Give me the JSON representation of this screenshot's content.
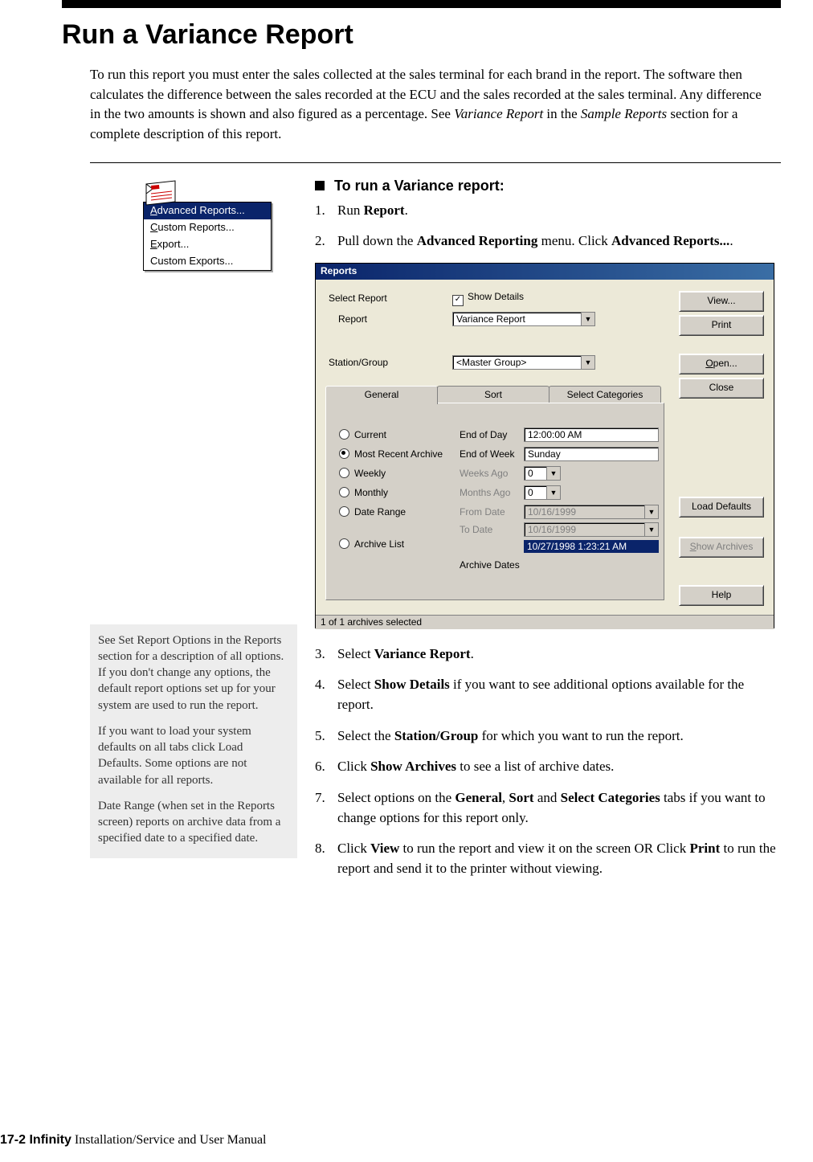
{
  "heading": "Run a Variance Report",
  "intro_a": "To run this report you must enter the sales collected at the sales terminal for each brand in the report. The software then calculates the difference between the sales recorded at the ECU and the sales recorded at the sales terminal. Any difference in the two amounts is shown and also figured as a percentage. See ",
  "intro_b": "Variance Report",
  "intro_c": " in the ",
  "intro_d": "Sample Reports",
  "intro_e": " section for a complete description of this report.",
  "task_title": "To run a Variance report:",
  "steps": {
    "s1_a": "Run ",
    "s1_b": "Report",
    "s1_c": ".",
    "s2_a": "Pull down the ",
    "s2_b": "Advanced Reporting",
    "s2_c": " menu. Click ",
    "s2_d": "Advanced Reports...",
    "s2_e": ".",
    "s3_a": "Select ",
    "s3_b": "Variance Report",
    "s3_c": ".",
    "s4_a": "Select ",
    "s4_b": "Show Details",
    "s4_c": " if you want to see additional options available for the report.",
    "s5_a": "Select the ",
    "s5_b": "Station/Group",
    "s5_c": " for which you want to run the report.",
    "s6_a": "Click ",
    "s6_b": "Show Archives",
    "s6_c": " to see a list of archive dates.",
    "s7_a": "Select options on the ",
    "s7_b": "General",
    "s7_c": ", ",
    "s7_d": "Sort",
    "s7_e": " and ",
    "s7_f": "Select Categories",
    "s7_g": " tabs if you want to change options for this report only.",
    "s8_a": "Click ",
    "s8_b": "View",
    "s8_c": " to run the report and view it on the screen OR Click ",
    "s8_d": "Print",
    "s8_e": " to run the report and send it to the printer without viewing."
  },
  "nums": {
    "n1": "1.",
    "n2": "2.",
    "n3": "3.",
    "n4": "4.",
    "n5": "5.",
    "n6": "6.",
    "n7": "7.",
    "n8": "8."
  },
  "dropdown": {
    "i0_u": "A",
    "i0_r": "dvanced Reports...",
    "i1_u": "C",
    "i1_r": "ustom Reports...",
    "i2_u": "E",
    "i2_r": "xport...",
    "i3": "Custom Exports..."
  },
  "notes": {
    "p1": "See Set Report Options in the Reports section for a description of all options. If you don't change any options, the default report options set up for your system are used to run the report.",
    "p2": "If you want to load your system defaults on all tabs click Load Defaults. Some options are not available for all reports.",
    "p3": "Date Range (when set in the Reports screen) reports on archive data from a specified date to a specified date."
  },
  "dlg": {
    "title": "Reports",
    "select_report": "Select Report",
    "show_details": "Show Details",
    "report": "Report",
    "report_value": "Variance Report",
    "station_group": "Station/Group",
    "station_value": "<Master Group>",
    "tabs": {
      "general": "General",
      "sort": "Sort",
      "select_categories": "Select Categories"
    },
    "radios": {
      "current": "Current",
      "most_recent": "Most Recent Archive",
      "weekly": "Weekly",
      "monthly": "Monthly",
      "date_range": "Date Range",
      "archive_list": "Archive List"
    },
    "labels": {
      "end_of_day": "End of Day",
      "end_of_week": "End of Week",
      "weeks_ago": "Weeks Ago",
      "months_ago": "Months Ago",
      "from_date": "From Date",
      "to_date": "To Date",
      "archive_dates": "Archive Dates"
    },
    "values": {
      "end_of_day": "12:00:00 AM",
      "end_of_week": "Sunday",
      "weeks_ago": "0",
      "months_ago": "0",
      "from_date": "10/16/1999",
      "to_date": "10/16/1999",
      "archive_selected": "10/27/1998 1:23:21 AM"
    },
    "buttons": {
      "view": "View...",
      "print": "Print",
      "open_u": "O",
      "open_r": "pen...",
      "close": "Close",
      "load_defaults": "Load Defaults",
      "show_archives_u": "S",
      "show_archives_r": "how Archives",
      "help": "Help"
    },
    "status": "1 of 1 archives selected"
  },
  "footer": {
    "pageref": "17-2  ",
    "product": "Infinity",
    "tail": " Installation/Service and User Manual"
  }
}
